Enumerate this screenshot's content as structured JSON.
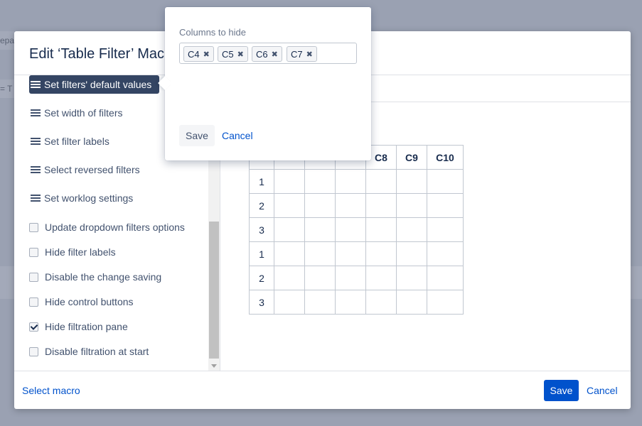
{
  "background": {
    "fragment_text_1": "epa",
    "fragment_text_2": "= T"
  },
  "modal": {
    "title": "Edit ‘Table Filter’ Mac",
    "sidebar": {
      "menu_items": [
        {
          "label": "Set filters' default values",
          "active": true
        },
        {
          "label": "Set width of filters",
          "active": false
        },
        {
          "label": "Set filter labels",
          "active": false
        },
        {
          "label": "Select reversed filters",
          "active": false
        },
        {
          "label": "Set worklog settings",
          "active": false
        }
      ],
      "checkbox_items": [
        {
          "label": "Update dropdown filters options",
          "checked": false
        },
        {
          "label": "Hide filter labels",
          "checked": false
        },
        {
          "label": "Disable the change saving",
          "checked": false
        },
        {
          "label": "Hide control buttons",
          "checked": false
        },
        {
          "label": "Hide filtration pane",
          "checked": true
        },
        {
          "label": "Disable filtration at start",
          "checked": false
        }
      ]
    },
    "preview_table": {
      "headers": [
        "",
        "",
        "",
        "",
        "C8",
        "C9",
        "C10"
      ],
      "row_numbers": [
        "1",
        "2",
        "3",
        "1",
        "2",
        "3"
      ]
    },
    "footer": {
      "select_macro": "Select macro",
      "save": "Save",
      "cancel": "Cancel"
    }
  },
  "popup": {
    "label": "Columns to hide",
    "tags": [
      "C4",
      "C5",
      "C6",
      "C7"
    ],
    "remove_glyph": "✖",
    "save": "Save",
    "cancel": "Cancel"
  },
  "colors": {
    "primary": "#0052cc",
    "active_item": "#344563",
    "overlay": "#9aa1b2"
  }
}
